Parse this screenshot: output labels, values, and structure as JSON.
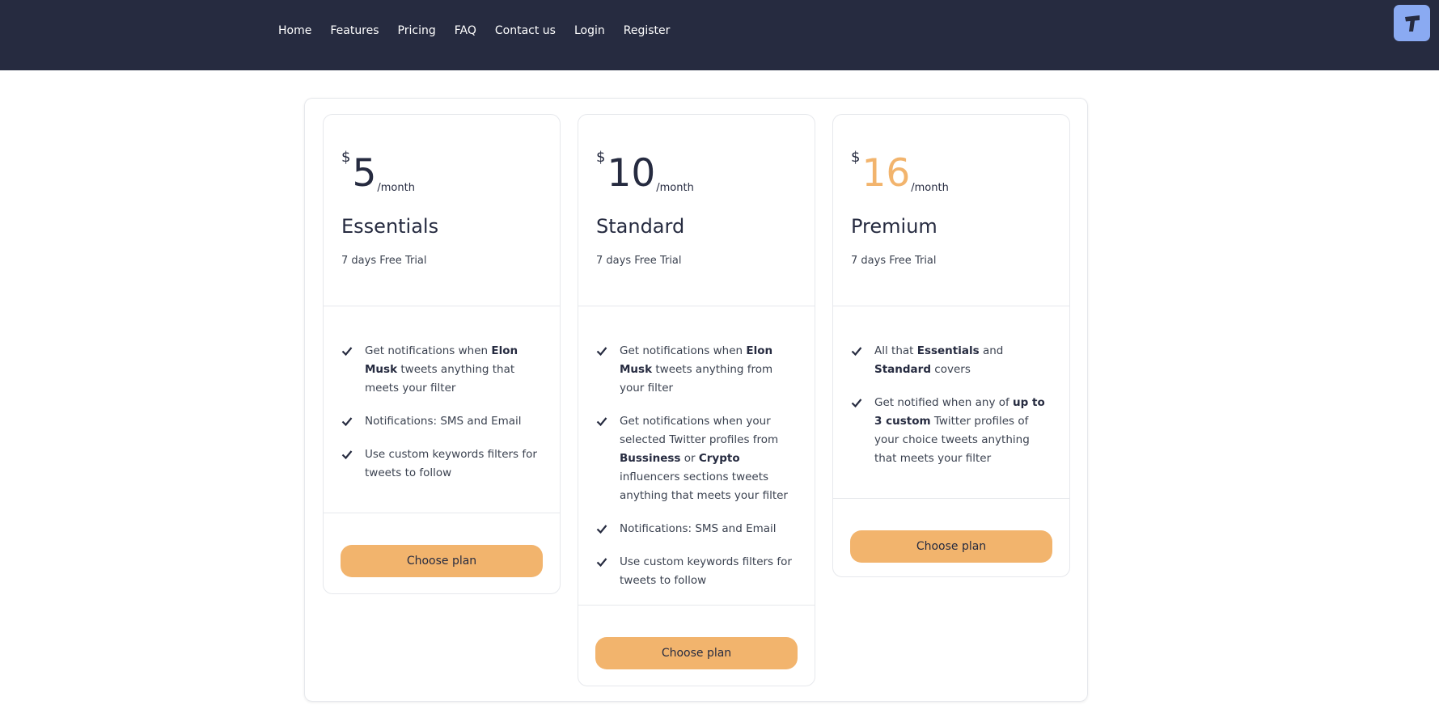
{
  "nav": {
    "items": [
      "Home",
      "Features",
      "Pricing",
      "FAQ",
      "Contact us",
      "Login",
      "Register"
    ]
  },
  "brand": {
    "icon": "t-logo-icon",
    "color": "#8aaaf2"
  },
  "colors": {
    "topbar": "#262b40",
    "accent": "#f2b46d",
    "text": "#262b40"
  },
  "plans": [
    {
      "currency": "$",
      "amount": "5",
      "period": "/month",
      "name": "Essentials",
      "trial": "7 days Free Trial",
      "cta": "Choose plan"
    },
    {
      "currency": "$",
      "amount": "10",
      "period": "/month",
      "name": "Standard",
      "trial": "7 days Free Trial",
      "cta": "Choose plan"
    },
    {
      "currency": "$",
      "amount": "16",
      "period": "/month",
      "name": "Premium",
      "trial": "7 days Free Trial",
      "cta": "Choose plan"
    }
  ],
  "features": {
    "essentials": {
      "f1_a": "Get notifications when ",
      "f1_b": "Elon Musk",
      "f1_c": " tweets anything that meets your filter",
      "f2": "Notifications: SMS and Email",
      "f3": "Use custom keywords filters for tweets to follow"
    },
    "standard": {
      "f1_a": "Get notifications when ",
      "f1_b": "Elon Musk",
      "f1_c": " tweets anything from your filter",
      "f2_a": "Get notifications when your selected Twitter profiles from ",
      "f2_b": "Bussiness",
      "f2_c": " or ",
      "f2_d": "Crypto",
      "f2_e": " influencers sections tweets anything that meets your filter",
      "f3": "Notifications: SMS and Email",
      "f4": "Use custom keywords filters for tweets to follow"
    },
    "premium": {
      "f1_a": "All that ",
      "f1_b": "Essentials",
      "f1_c": " and ",
      "f1_d": "Standard",
      "f1_e": " covers",
      "f2_a": "Get notified when any of ",
      "f2_b": "up to 3 custom",
      "f2_c": " Twitter profiles of your choice tweets anything that meets your filter"
    }
  }
}
